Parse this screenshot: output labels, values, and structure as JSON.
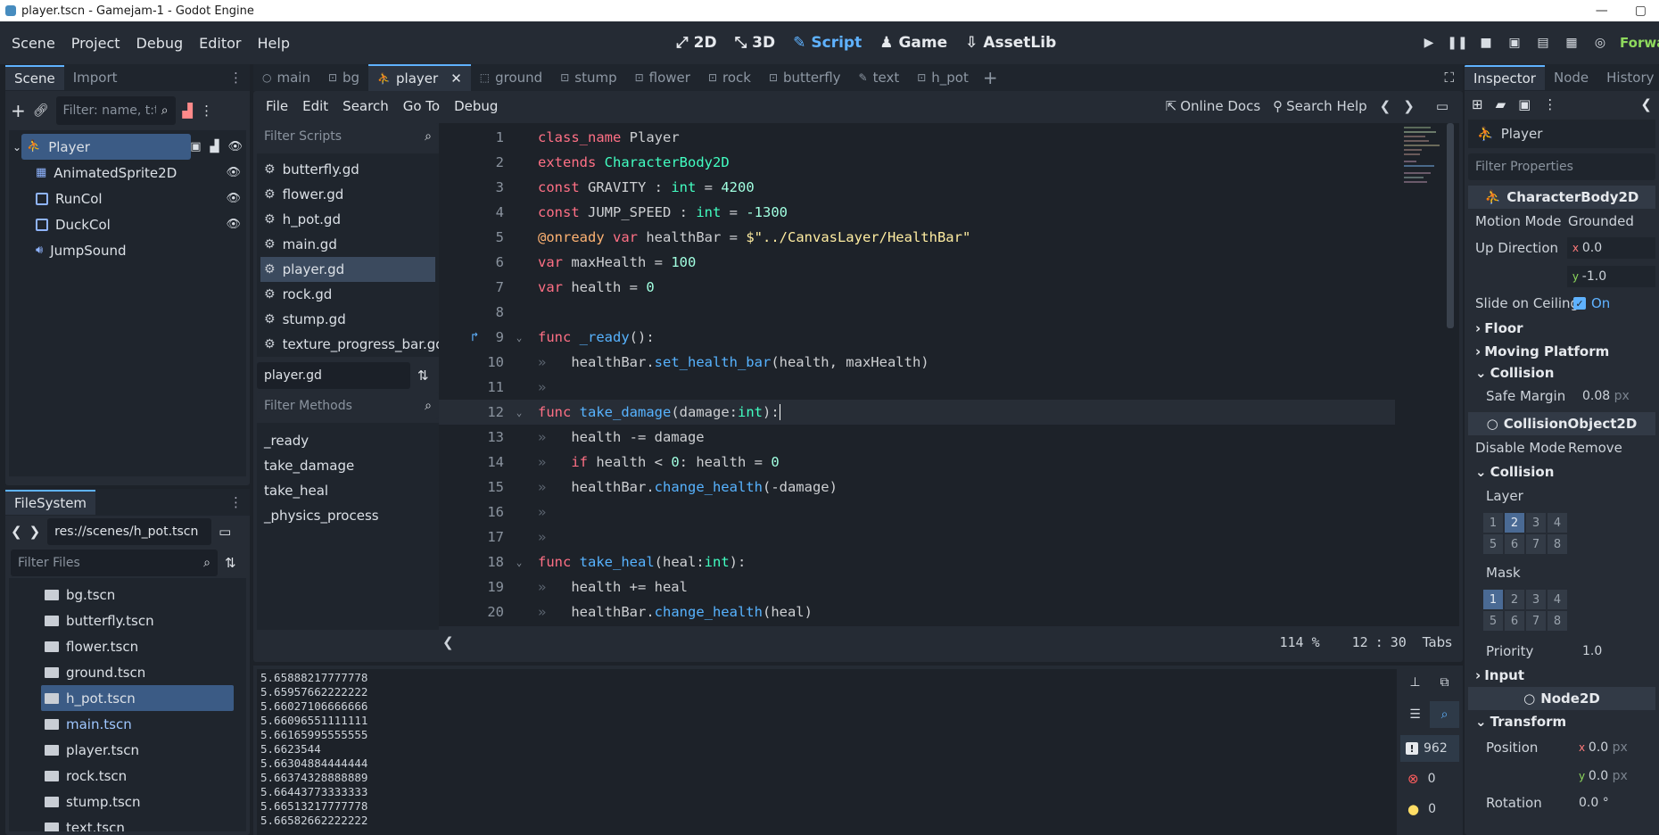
{
  "window": {
    "title": "player.tscn - Gamejam-1 - Godot Engine",
    "min": "—",
    "max": "▢"
  },
  "menu": [
    "Scene",
    "Project",
    "Debug",
    "Editor",
    "Help"
  ],
  "workspaces": [
    {
      "label": "2D",
      "icon": "2d-icon"
    },
    {
      "label": "3D",
      "icon": "3d-icon"
    },
    {
      "label": "Script",
      "icon": "script-icon",
      "active": true
    },
    {
      "label": "Game",
      "icon": "game-icon"
    },
    {
      "label": "AssetLib",
      "icon": "assetlib-icon"
    }
  ],
  "renderer": "Forwa",
  "scene_dock": {
    "tabs": [
      "Scene",
      "Import"
    ],
    "filter_placeholder": "Filter: name, t:t",
    "tree": [
      {
        "label": "Player",
        "icon": "characterbody2d-icon",
        "selected": true,
        "depth": 0
      },
      {
        "label": "AnimatedSprite2D",
        "icon": "animatedsprite-icon",
        "depth": 1,
        "eye": true
      },
      {
        "label": "RunCol",
        "icon": "collisionshape-icon",
        "depth": 1,
        "eye": true
      },
      {
        "label": "DuckCol",
        "icon": "collisionshape-icon",
        "depth": 1,
        "eye": true
      },
      {
        "label": "JumpSound",
        "icon": "audio-icon",
        "depth": 1
      }
    ]
  },
  "filesystem": {
    "tab": "FileSystem",
    "path": "res://scenes/h_pot.tscn",
    "filter_placeholder": "Filter Files",
    "files": [
      "bg.tscn",
      "butterfly.tscn",
      "flower.tscn",
      "ground.tscn",
      "h_pot.tscn",
      "main.tscn",
      "player.tscn",
      "rock.tscn",
      "stump.tscn",
      "text.tscn"
    ],
    "selected": "h_pot.tscn"
  },
  "scene_tabs": [
    "main",
    "bg",
    "player",
    "ground",
    "stump",
    "flower",
    "rock",
    "butterfly",
    "text",
    "h_pot"
  ],
  "active_scene_tab": "player",
  "script_menu": [
    "File",
    "Edit",
    "Search",
    "Go To",
    "Debug"
  ],
  "script_toolbar": {
    "online_docs": "Online Docs",
    "search_help": "Search Help"
  },
  "scripts_panel": {
    "filter_placeholder": "Filter Scripts",
    "scripts": [
      "butterfly.gd",
      "flower.gd",
      "h_pot.gd",
      "main.gd",
      "player.gd",
      "rock.gd",
      "stump.gd",
      "texture_progress_bar.gd"
    ],
    "selected": "player.gd",
    "current_file": "player.gd",
    "methods_placeholder": "Filter Methods",
    "methods": [
      "_ready",
      "take_damage",
      "take_heal",
      "_physics_process"
    ]
  },
  "code": {
    "lines": [
      {
        "n": "1",
        "tokens": [
          [
            "kw",
            "class_name"
          ],
          [
            "tx",
            " Player"
          ]
        ]
      },
      {
        "n": "2",
        "tokens": [
          [
            "kw",
            "extends"
          ],
          [
            "tx",
            " "
          ],
          [
            "ty",
            "CharacterBody2D"
          ]
        ]
      },
      {
        "n": "3",
        "tokens": [
          [
            "kw",
            "const"
          ],
          [
            "tx",
            " GRAVITY : "
          ],
          [
            "ty",
            "int"
          ],
          [
            "tx",
            " = "
          ],
          [
            "num",
            "4200"
          ]
        ]
      },
      {
        "n": "4",
        "tokens": [
          [
            "kw",
            "const"
          ],
          [
            "tx",
            " JUMP_SPEED : "
          ],
          [
            "ty",
            "int"
          ],
          [
            "tx",
            " = "
          ],
          [
            "num",
            "-1300"
          ]
        ]
      },
      {
        "n": "5",
        "tokens": [
          [
            "an",
            "@onready"
          ],
          [
            "tx",
            " "
          ],
          [
            "kw",
            "var"
          ],
          [
            "tx",
            " healthBar = "
          ],
          [
            "str",
            "$\"../CanvasLayer/HealthBar\""
          ]
        ]
      },
      {
        "n": "6",
        "tokens": [
          [
            "kw",
            "var"
          ],
          [
            "tx",
            " maxHealth = "
          ],
          [
            "num",
            "100"
          ]
        ]
      },
      {
        "n": "7",
        "tokens": [
          [
            "kw",
            "var"
          ],
          [
            "tx",
            " health = "
          ],
          [
            "num",
            "0"
          ]
        ]
      },
      {
        "n": "8",
        "tokens": []
      },
      {
        "n": "9",
        "fold": true,
        "override": true,
        "tokens": [
          [
            "kw",
            "func"
          ],
          [
            "tx",
            " "
          ],
          [
            "fn",
            "_ready"
          ],
          [
            "tx",
            "():"
          ]
        ]
      },
      {
        "n": "10",
        "indent": true,
        "tokens": [
          [
            "tx",
            "healthBar."
          ],
          [
            "fn",
            "set_health_bar"
          ],
          [
            "tx",
            "(health, maxHealth)"
          ]
        ]
      },
      {
        "n": "11",
        "indent": true,
        "tokens": []
      },
      {
        "n": "12",
        "fold": true,
        "current": true,
        "tokens": [
          [
            "kw",
            "func"
          ],
          [
            "tx",
            " "
          ],
          [
            "fn",
            "take_damage"
          ],
          [
            "tx",
            "(damage:"
          ],
          [
            "ty",
            "int"
          ],
          [
            "tx",
            "):"
          ]
        ]
      },
      {
        "n": "13",
        "indent": true,
        "tokens": [
          [
            "tx",
            "health -= damage"
          ]
        ]
      },
      {
        "n": "14",
        "indent": true,
        "tokens": [
          [
            "kw",
            "if"
          ],
          [
            "tx",
            " health < "
          ],
          [
            "num",
            "0"
          ],
          [
            "tx",
            ": health = "
          ],
          [
            "num",
            "0"
          ]
        ]
      },
      {
        "n": "15",
        "indent": true,
        "tokens": [
          [
            "tx",
            "healthBar."
          ],
          [
            "fn",
            "change_health"
          ],
          [
            "tx",
            "(-damage)"
          ]
        ]
      },
      {
        "n": "16",
        "indent": true,
        "tokens": []
      },
      {
        "n": "17",
        "indent": true,
        "tokens": []
      },
      {
        "n": "18",
        "fold": true,
        "tokens": [
          [
            "kw",
            "func"
          ],
          [
            "tx",
            " "
          ],
          [
            "fn",
            "take_heal"
          ],
          [
            "tx",
            "(heal:"
          ],
          [
            "ty",
            "int"
          ],
          [
            "tx",
            "):"
          ]
        ]
      },
      {
        "n": "19",
        "indent": true,
        "tokens": [
          [
            "tx",
            "health += heal"
          ]
        ]
      },
      {
        "n": "20",
        "indent": true,
        "tokens": [
          [
            "tx",
            "healthBar."
          ],
          [
            "fn",
            "change_health"
          ],
          [
            "tx",
            "(heal)"
          ]
        ]
      }
    ]
  },
  "status": {
    "zoom": "114 %",
    "line": "12",
    "col": "30",
    "indent": "Tabs"
  },
  "output": {
    "lines": [
      "5.65888217777778",
      "5.65957662222222",
      "5.66027106666666",
      "5.66096551111111",
      "5.66165995555555",
      "5.6623544",
      "5.66304884444444",
      "5.66374328888889",
      "5.66443773333333",
      "5.66513217777778",
      "5.66582662222222"
    ],
    "messages": "962",
    "errors": "0",
    "warnings": "0"
  },
  "inspector": {
    "tabs": [
      "Inspector",
      "Node",
      "History"
    ],
    "object": "Player",
    "filter_placeholder": "Filter Properties",
    "class1": "CharacterBody2D",
    "motion_mode_label": "Motion Mode",
    "motion_mode": "Grounded",
    "up_direction_label": "Up Direction",
    "up_x": "0.0",
    "up_y": "-1.0",
    "slide_label": "Slide on Ceiling",
    "slide_value": "On",
    "floor": "Floor",
    "moving_platform": "Moving Platform",
    "collision": "Collision",
    "safe_margin_label": "Safe Margin",
    "safe_margin": "0.08",
    "px": "px",
    "class2": "CollisionObject2D",
    "disable_mode_label": "Disable Mode",
    "disable_mode": "Remove",
    "collision2": "Collision",
    "layer_label": "Layer",
    "mask_label": "Mask",
    "layer_on": "2",
    "mask_on": "1",
    "grid": [
      "1",
      "2",
      "3",
      "4",
      "5",
      "6",
      "7",
      "8"
    ],
    "priority_label": "Priority",
    "priority": "1.0",
    "input": "Input",
    "class3": "Node2D",
    "transform": "Transform",
    "position_label": "Position",
    "pos_x": "0.0",
    "pos_y": "0.0",
    "rotation_label": "Rotation",
    "rotation": "0.0 °"
  }
}
